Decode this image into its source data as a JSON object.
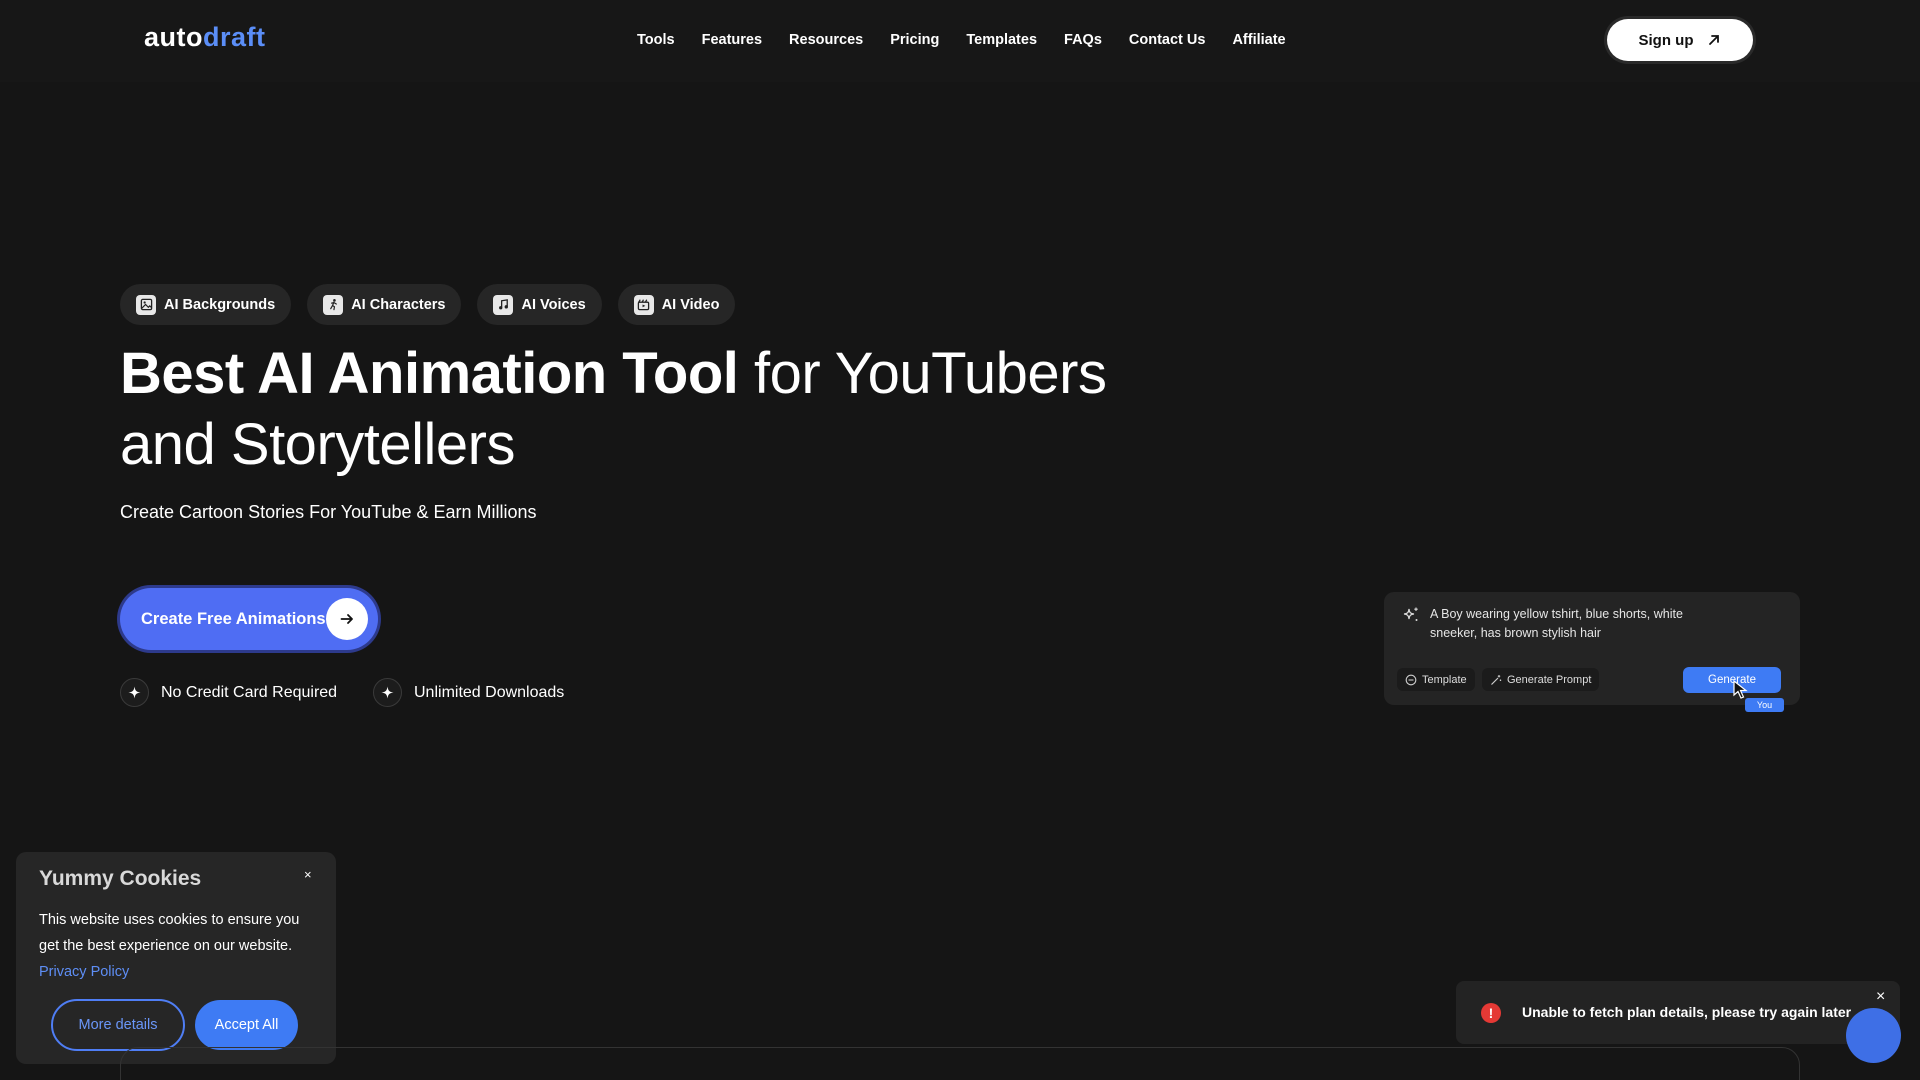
{
  "header": {
    "logo_part1": "auto",
    "logo_part2": "draft",
    "nav": [
      "Tools",
      "Features",
      "Resources",
      "Pricing",
      "Templates",
      "FAQs",
      "Contact Us",
      "Affiliate"
    ],
    "signup_label": "Sign up",
    "signup_icon": "arrow-up-right-icon"
  },
  "chips": [
    {
      "label": "AI Backgrounds",
      "icon": "image-icon"
    },
    {
      "label": "AI Characters",
      "icon": "running-figure-icon"
    },
    {
      "label": "AI Voices",
      "icon": "music-note-icon"
    },
    {
      "label": "AI Video",
      "icon": "video-clapper-icon"
    }
  ],
  "hero": {
    "title_bold": "Best AI Animation Tool",
    "title_rest": " for YouTubers and Storytellers",
    "subtitle": "Create Cartoon Stories For YouTube & Earn Millions",
    "cta_label": "Create Free Animations",
    "benefits": [
      "No Credit Card Required",
      "Unlimited Downloads"
    ]
  },
  "prompt_demo": {
    "text": "A Boy wearing yellow tshirt, blue shorts, white sneeker, has brown stylish hair",
    "template_label": "Template",
    "generate_prompt_label": "Generate Prompt",
    "generate_label": "Generate",
    "you_label": "You"
  },
  "cookie": {
    "title": "Yummy Cookies",
    "close": "×",
    "body": "This website uses cookies to ensure you get the best experience on our website. ",
    "link": "Privacy Policy",
    "more_label": "More details",
    "accept_label": "Accept All"
  },
  "toast": {
    "icon": "!",
    "message": "Unable to fetch plan details, please try again later",
    "close": "×"
  },
  "colors": {
    "background": "#151515",
    "accent": "#4f6df3",
    "link": "#5e8ef5",
    "error": "#e53935"
  }
}
